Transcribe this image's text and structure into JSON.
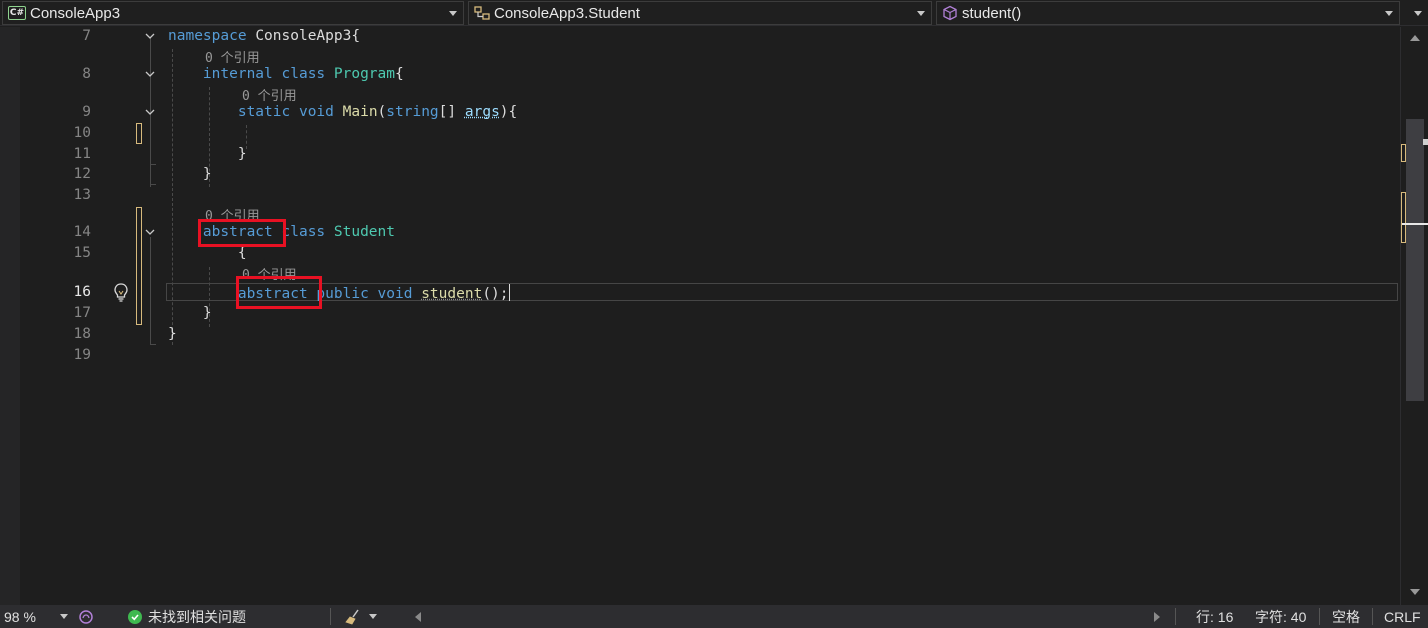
{
  "navbar": {
    "project": "ConsoleApp3",
    "type": "ConsoleApp3.Student",
    "member": "student()"
  },
  "editor": {
    "line_numbers": [
      "7",
      "8",
      "9",
      "10",
      "11",
      "12",
      "13",
      "14",
      "15",
      "16",
      "17",
      "18",
      "19"
    ],
    "current_line": "16",
    "codelens": "0 个引用",
    "lines": {
      "l7": {
        "kw": "namespace",
        "name": "ConsoleApp3",
        "punct": "{"
      },
      "l8": {
        "kw1": "internal",
        "kw2": "class",
        "name": "Program",
        "punct": "{"
      },
      "l9": {
        "kw1": "static",
        "kw2": "void",
        "name": "Main",
        "open": "(",
        "ptype": "string",
        "arr": "[]",
        "pname": "args",
        "close": "){"
      },
      "l11": {
        "punct": "}"
      },
      "l12": {
        "punct": "}"
      },
      "l14": {
        "kw1": "abstract",
        "kw2": "class",
        "name": "Student"
      },
      "l15": {
        "punct": "{"
      },
      "l16": {
        "kw1": "abstract",
        "kw2": "public",
        "kw3": "void",
        "name": "student",
        "punct": "();"
      },
      "l17": {
        "punct": "}"
      },
      "l18": {
        "punct": "}"
      }
    }
  },
  "statusbar": {
    "zoom": "98 %",
    "issues": "未找到相关问题",
    "line": "行: 16",
    "col": "字符: 40",
    "whitespace": "空格",
    "eol": "CRLF"
  },
  "colors": {
    "keyword": "#569cd6",
    "type": "#4ec9b0",
    "method": "#dcdcaa",
    "parameter": "#9cdcfe",
    "highlight_box": "#e81123",
    "change_marker": "#d7ba7d"
  }
}
